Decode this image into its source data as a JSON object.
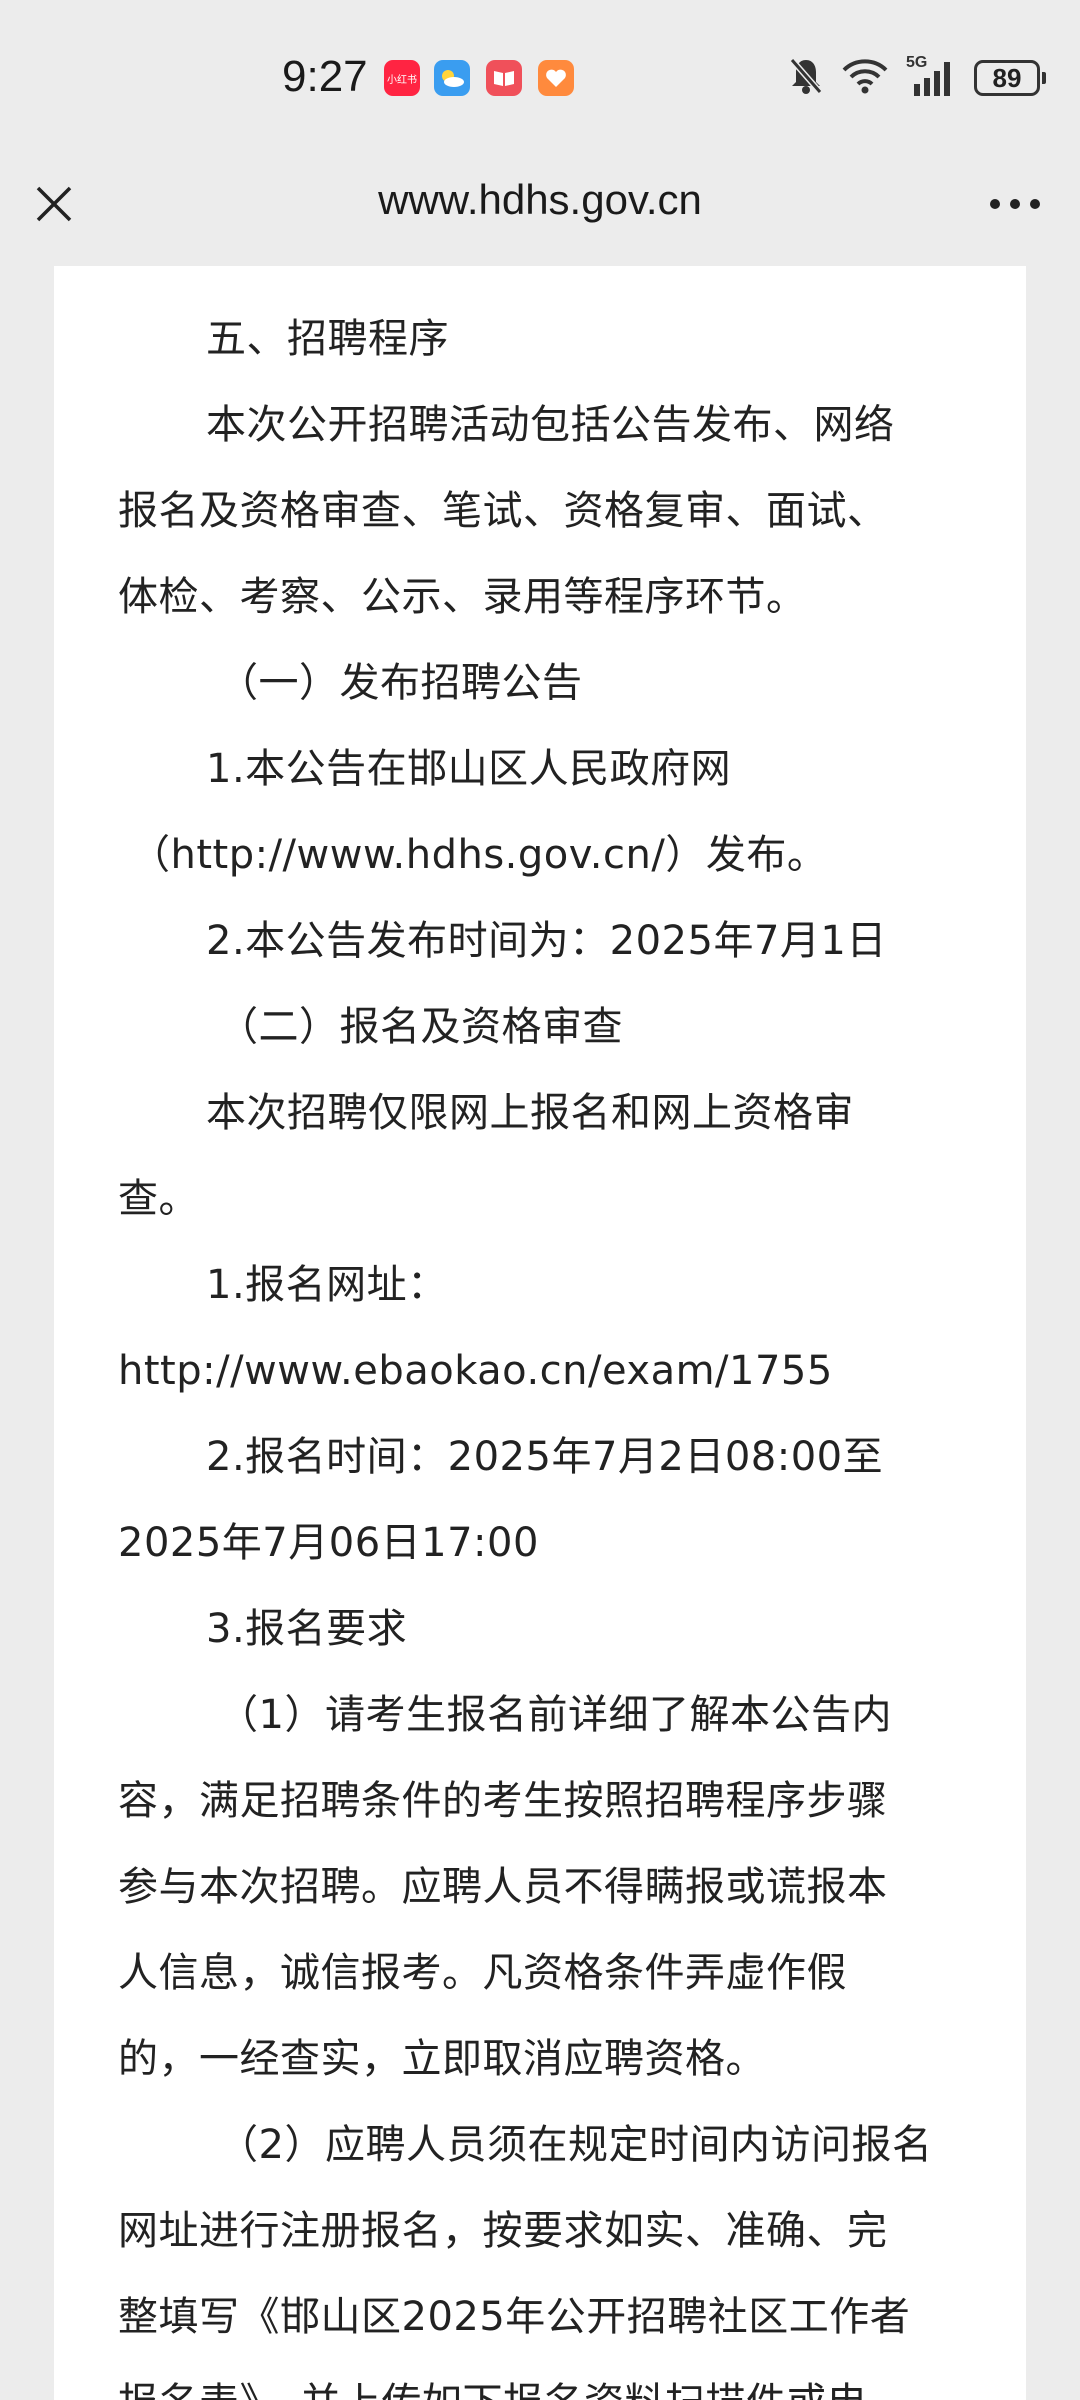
{
  "status_bar": {
    "time": "9:27",
    "app_icons": [
      {
        "name": "xiaohongshu-icon",
        "text": "小红书",
        "color": "#ff2442"
      },
      {
        "name": "weather-icon",
        "text": "",
        "color": "#3a9df0"
      },
      {
        "name": "reader-icon",
        "text": "",
        "color": "#f0505a"
      },
      {
        "name": "health-icon",
        "text": "",
        "color": "#ff8a3d"
      }
    ],
    "network": "5G",
    "battery": "89"
  },
  "nav": {
    "url": "www.hdhs.gov.cn"
  },
  "article": {
    "lines": [
      "五、招聘程序",
      "本次公开招聘活动包括公告发布、网络",
      "报名及资格审查、笔试、资格复审、面试、",
      "体检、考察、公示、录用等程序环节。",
      "（一）发布招聘公告",
      "1.本公告在邯山区人民政府网",
      "（http://www.hdhs.gov.cn/）发布。",
      "2.本公告发布时间为：2025年7月1日",
      "（二）报名及资格审查",
      "本次招聘仅限网上报名和网上资格审",
      "查。",
      "1.报名网址：",
      "http://www.ebaokao.cn/exam/1755",
      "2.报名时间：2025年7月2日08:00至",
      "2025年7月06日17:00",
      "3.报名要求",
      "（1）请考生报名前详细了解本公告内",
      "容，满足招聘条件的考生按照招聘程序步骤",
      "参与本次招聘。应聘人员不得瞒报或谎报本",
      "人信息，诚信报考。凡资格条件弄虚作假",
      "的，一经查实，立即取消应聘资格。",
      "（2）应聘人员须在规定时间内访问报名",
      "网址进行注册报名，按要求如实、准确、完",
      "整填写《邯山区2025年公开招聘社区工作者",
      "报名表》，并上传如下报名资料扫描件或电"
    ]
  }
}
